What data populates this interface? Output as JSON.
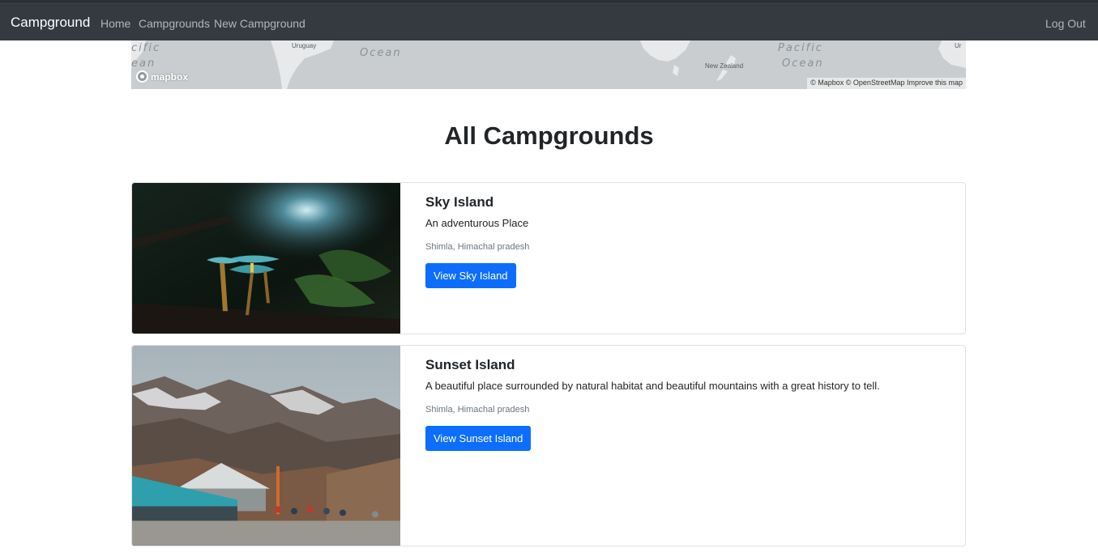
{
  "navbar": {
    "brand": "Campground",
    "links": [
      {
        "label": "Home"
      },
      {
        "label": "Campgrounds"
      },
      {
        "label": "New Campground"
      }
    ],
    "logout_label": "Log Out",
    "background": "#343a40"
  },
  "map": {
    "ocean_labels": [
      "cific",
      "ean",
      "Ocean",
      "Pacific",
      "Ocean"
    ],
    "place_labels": [
      "Uruguay",
      "New Zealand",
      "Ur"
    ],
    "logo_text": "mapbox",
    "attribution": "© Mapbox © OpenStreetMap Improve this map"
  },
  "page": {
    "title": "All Campgrounds"
  },
  "campgrounds": [
    {
      "title": "Sky Island",
      "description": "An adventurous Place",
      "location": "Shimla, Himachal pradesh",
      "button_label": "View Sky Island"
    },
    {
      "title": "Sunset Island",
      "description": "A beautiful place surrounded by natural habitat and beautiful mountains with a great history to tell.",
      "location": "Shimla, Himachal pradesh",
      "button_label": "View Sunset Island"
    }
  ],
  "colors": {
    "primary_button": "#0d6efd",
    "muted_text": "#6c757d",
    "map_water": "#c9cdcf"
  }
}
